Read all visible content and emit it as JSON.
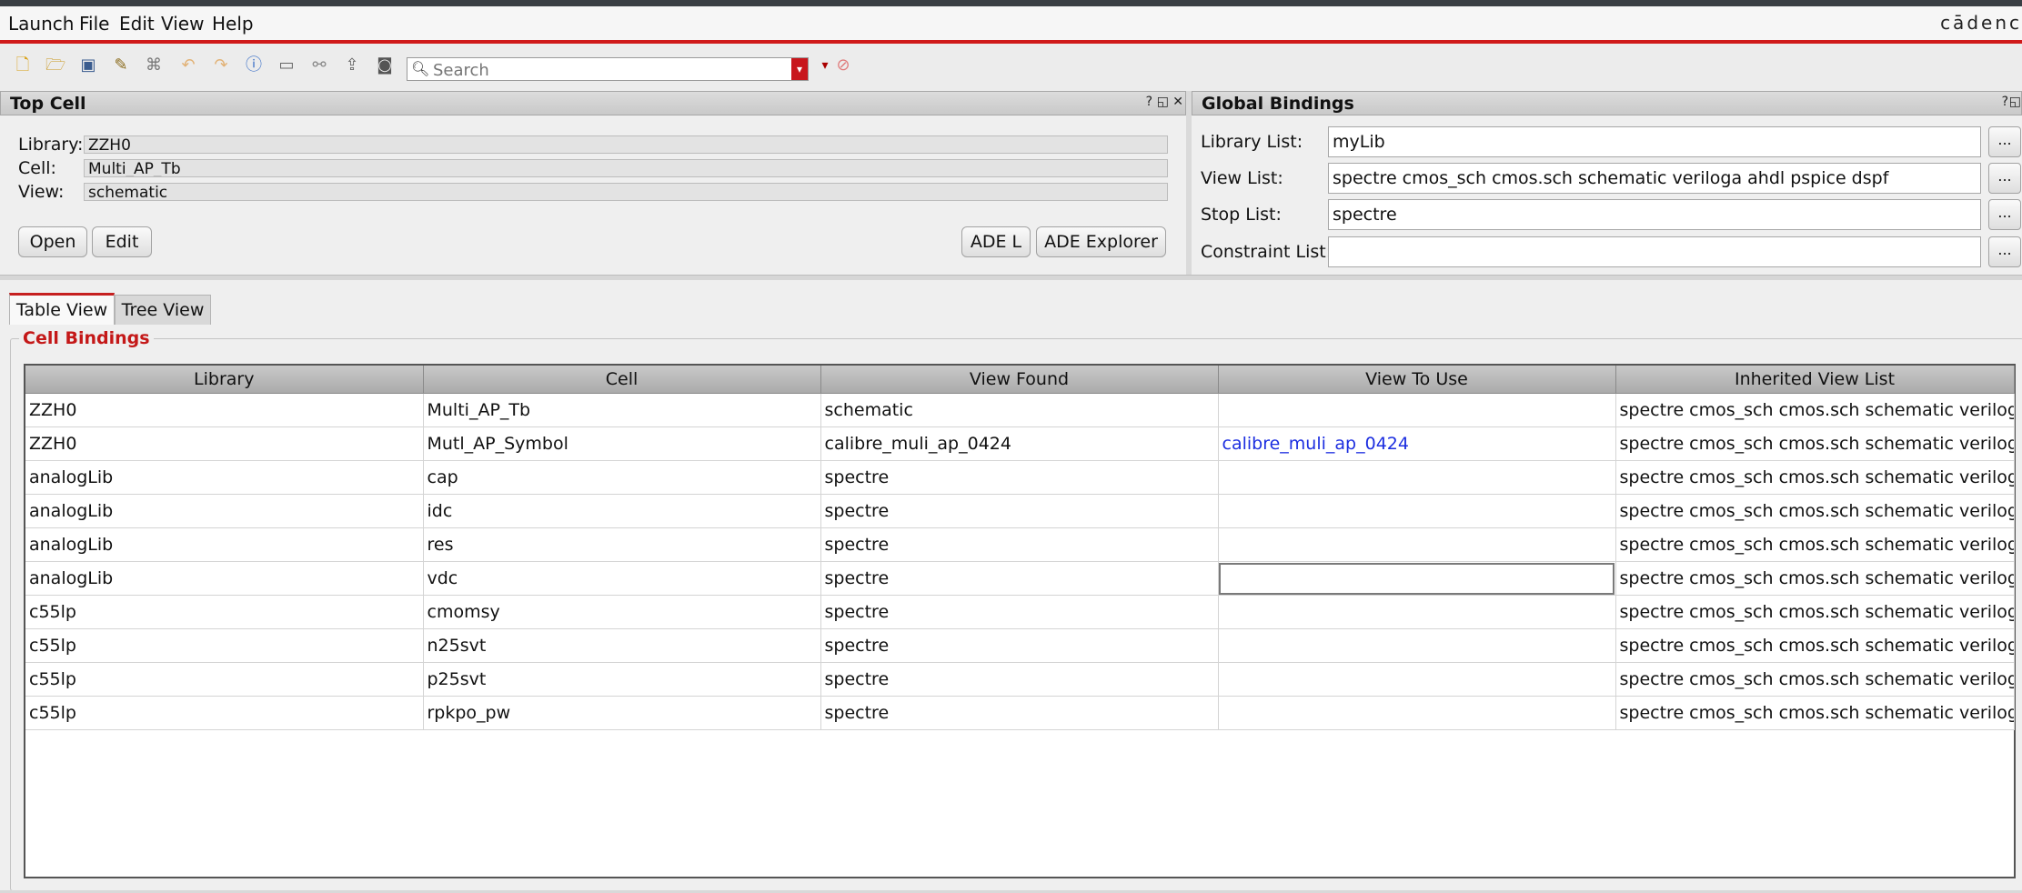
{
  "menubar": {
    "items": [
      "Launch",
      "File",
      "Edit",
      "View",
      "Help"
    ],
    "brand": "cādenc"
  },
  "toolbar": {
    "icons": [
      "new-file-icon",
      "open-folder-icon",
      "save-icon",
      "edit-icon",
      "hierarchy-icon",
      "undo-icon",
      "redo-icon",
      "info-icon",
      "window-icon",
      "network-icon",
      "export-icon",
      "camera-icon"
    ],
    "search": {
      "placeholder": "Search",
      "value": ""
    }
  },
  "top_cell": {
    "title": "Top Cell",
    "library_label": "Library:",
    "library_value": "ZZH0",
    "cell_label": "Cell:",
    "cell_value": "Multi_AP_Tb",
    "view_label": "View:",
    "view_value": "schematic",
    "open_label": "Open",
    "edit_label": "Edit",
    "ade_l_label": "ADE L",
    "ade_explorer_label": "ADE Explorer",
    "help_glyph": "?",
    "float_glyph": "◱",
    "close_glyph": "✕"
  },
  "global_bindings": {
    "title": "Global Bindings",
    "library_list_label": "Library List:",
    "library_list_value": "myLib",
    "view_list_label": "View List:",
    "view_list_value": "spectre cmos_sch cmos.sch schematic veriloga ahdl pspice dspf",
    "stop_list_label": "Stop List:",
    "stop_list_value": "spectre",
    "constraint_list_label": "Constraint List:",
    "constraint_list_value": "",
    "dots_label": "...",
    "help_glyph": "?",
    "float_glyph": "◱"
  },
  "tabs": [
    {
      "label": "Table View",
      "active": true
    },
    {
      "label": "Tree View",
      "active": false
    }
  ],
  "cell_bindings": {
    "title": "Cell Bindings",
    "columns": [
      "Library",
      "Cell",
      "View Found",
      "View To Use",
      "Inherited View List"
    ],
    "rows": [
      [
        "ZZH0",
        "Multi_AP_Tb",
        "schematic",
        "",
        "spectre cmos_sch cmos.sch schematic veriloga ..."
      ],
      [
        "ZZH0",
        "Mutl_AP_Symbol",
        "calibre_muli_ap_0424",
        "calibre_muli_ap_0424",
        "spectre cmos_sch cmos.sch schematic veriloga ..."
      ],
      [
        "analogLib",
        "cap",
        "spectre",
        "",
        "spectre cmos_sch cmos.sch schematic veriloga ..."
      ],
      [
        "analogLib",
        "idc",
        "spectre",
        "",
        "spectre cmos_sch cmos.sch schematic veriloga ..."
      ],
      [
        "analogLib",
        "res",
        "spectre",
        "",
        "spectre cmos_sch cmos.sch schematic veriloga ..."
      ],
      [
        "analogLib",
        "vdc",
        "spectre",
        "",
        "spectre cmos_sch cmos.sch schematic veriloga ..."
      ],
      [
        "c55lp",
        "cmomsy",
        "spectre",
        "",
        "spectre cmos_sch cmos.sch schematic veriloga ..."
      ],
      [
        "c55lp",
        "n25svt",
        "spectre",
        "",
        "spectre cmos_sch cmos.sch schematic veriloga ..."
      ],
      [
        "c55lp",
        "p25svt",
        "spectre",
        "",
        "spectre cmos_sch cmos.sch schematic veriloga ..."
      ],
      [
        "c55lp",
        "rpkpo_pw",
        "spectre",
        "",
        "spectre cmos_sch cmos.sch schematic veriloga ..."
      ]
    ],
    "link_color": "#1c2ee0",
    "focused_cell": [
      5,
      3
    ]
  }
}
